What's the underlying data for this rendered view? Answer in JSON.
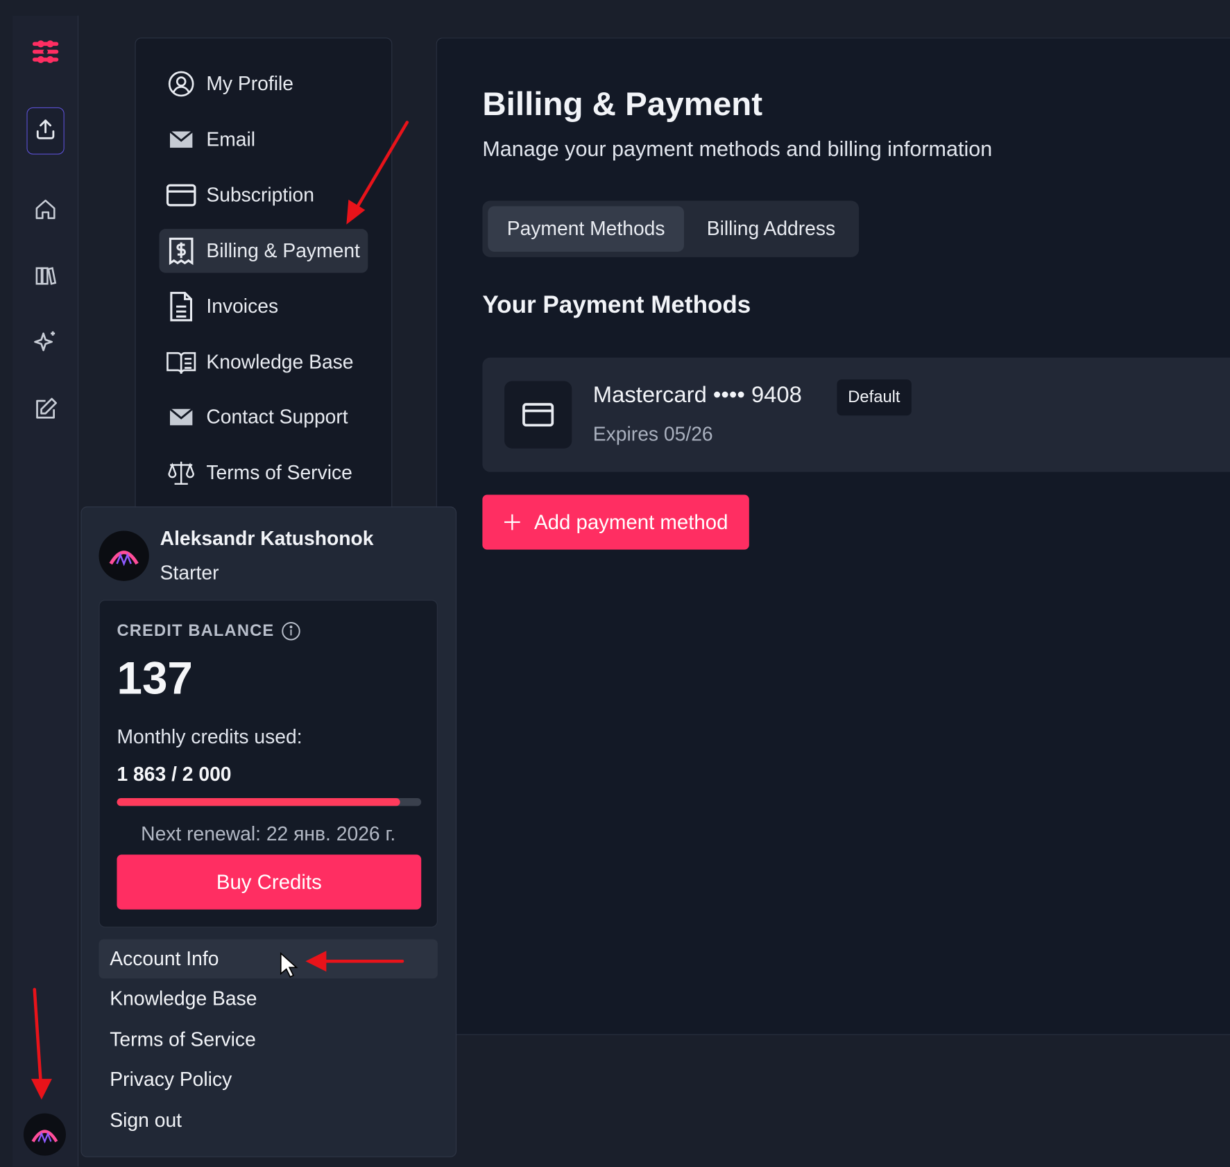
{
  "colors": {
    "accent": "#ff2e62",
    "progress": "#ff3b5c",
    "annotation": "#e8131a"
  },
  "rail": {
    "icons": [
      "app-logo-icon",
      "upload-icon",
      "home-icon",
      "library-icon",
      "sparkle-icon",
      "edit-icon",
      "avatar"
    ]
  },
  "settings_nav": {
    "items": [
      {
        "label": "My Profile",
        "icon": "user-circle-icon"
      },
      {
        "label": "Email",
        "icon": "mail-icon"
      },
      {
        "label": "Subscription",
        "icon": "credit-card-icon"
      },
      {
        "label": "Billing & Payment",
        "icon": "receipt-dollar-icon",
        "active": true
      },
      {
        "label": "Invoices",
        "icon": "document-icon"
      },
      {
        "label": "Knowledge Base",
        "icon": "open-book-icon"
      },
      {
        "label": "Contact Support",
        "icon": "mail-icon"
      },
      {
        "label": "Terms of Service",
        "icon": "scales-icon"
      }
    ]
  },
  "main": {
    "title": "Billing & Payment",
    "subtitle": "Manage your payment methods and billing information",
    "tabs": [
      {
        "label": "Payment Methods",
        "active": true
      },
      {
        "label": "Billing Address",
        "active": false
      }
    ],
    "section_title": "Your Payment Methods",
    "payment_method": {
      "name": "Mastercard •••• 9408",
      "badge": "Default",
      "expires": "Expires 05/26"
    },
    "add_button": "Add payment method"
  },
  "account_menu": {
    "user_name": "Aleksandr Katushonok",
    "plan": "Starter",
    "credit_label": "CREDIT BALANCE",
    "credit_value": "137",
    "monthly_label": "Monthly credits used:",
    "monthly_used": "1 863 / 2 000",
    "usage_fraction": 0.9315,
    "renewal": "Next renewal: 22 янв. 2026 г.",
    "buy_button": "Buy Credits",
    "items": [
      "Account Info",
      "Knowledge Base",
      "Terms of Service",
      "Privacy Policy",
      "Sign out"
    ]
  }
}
